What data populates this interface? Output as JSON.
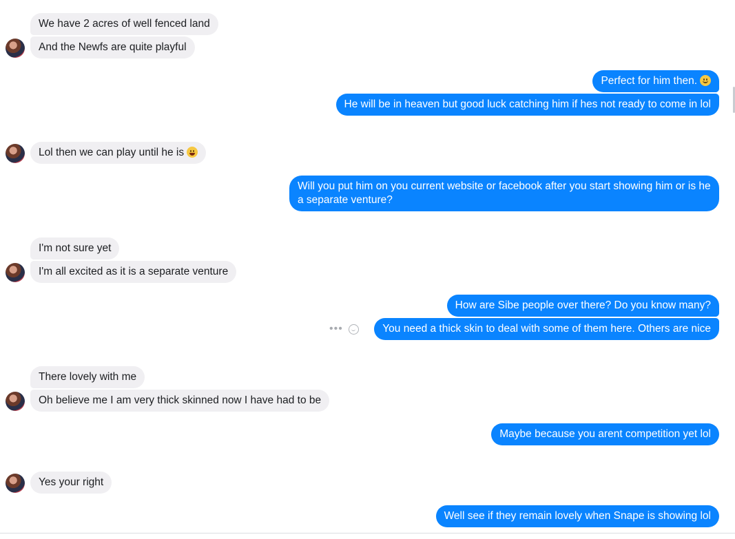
{
  "messages": {
    "m1": "We have 2 acres of well fenced land",
    "m2": "And the Newfs are quite playful",
    "m3": "Perfect for him then.",
    "m4": "He will be in heaven but good luck catching him if hes not ready to come in lol",
    "m5": "Lol then we can play until he is",
    "m6": "Will you put him on you current website or facebook after you start showing him or is he a separate venture?",
    "m7": "I'm not sure yet",
    "m8": "I'm all excited as it is a separate  venture",
    "m9": "How are Sibe people over there? Do you know many?",
    "m10": "You need a thick skin to deal with some of them here. Others are nice",
    "m11": "There lovely with me",
    "m12": "Oh believe me I am very thick skinned now I have had to be",
    "m13": "Maybe because you arent competition yet lol",
    "m14": "Yes your right",
    "m15": "Well see if they remain lovely when Snape is showing lol"
  },
  "actions": {
    "more": "•••"
  },
  "icons": {
    "smile_emoji": "slightly-smiling-face-emoji",
    "laugh_emoji": "tears-of-joy-emoji",
    "react": "add-reaction-icon",
    "more": "more-options-icon"
  },
  "colors": {
    "outgoing_bubble": "#0a84ff",
    "incoming_bubble": "#f0eff2",
    "text_dark": "#1c1e21"
  }
}
